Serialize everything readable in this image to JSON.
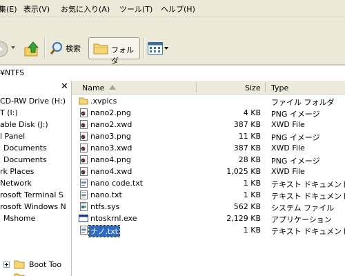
{
  "menu": {
    "items": [
      "集(E)",
      "表示(V)",
      "お気に入り(A)",
      "ツール(T)",
      "ヘルプ(H)"
    ]
  },
  "toolbar": {
    "search_label": "検索",
    "folders_label": "フォルダ"
  },
  "address": {
    "value": "¥NTFS"
  },
  "tree": {
    "items": [
      "CD-RW Drive (H:)",
      "T (I:)",
      "able Disk (J:)",
      "l Panel",
      "Documents",
      "Documents",
      "rk Places",
      "Network",
      "rosoft Terminal S",
      "rosoft Windows N",
      "Mshome",
      "Boot Too"
    ]
  },
  "list": {
    "columns": {
      "name": "Name",
      "size": "Size",
      "type": "Type"
    },
    "files": [
      {
        "name": ".xvpics",
        "size": "",
        "type": "ファイル フォルダ",
        "icon": "folder-icon"
      },
      {
        "name": "nano2.png",
        "size": "4 KB",
        "type": "PNG イメージ",
        "icon": "image-file-icon"
      },
      {
        "name": "nano2.xwd",
        "size": "387 KB",
        "type": "XWD File",
        "icon": "image-file-icon"
      },
      {
        "name": "nano3.png",
        "size": "11 KB",
        "type": "PNG イメージ",
        "icon": "image-file-icon"
      },
      {
        "name": "nano3.xwd",
        "size": "387 KB",
        "type": "XWD File",
        "icon": "image-file-icon"
      },
      {
        "name": "nano4.png",
        "size": "28 KB",
        "type": "PNG イメージ",
        "icon": "image-file-icon"
      },
      {
        "name": "nano4.xwd",
        "size": "1,025 KB",
        "type": "XWD File",
        "icon": "image-file-icon"
      },
      {
        "name": "nano code.txt",
        "size": "1 KB",
        "type": "テキスト ドキュメント",
        "icon": "text-file-icon"
      },
      {
        "name": "nano.txt",
        "size": "1 KB",
        "type": "テキスト ドキュメント",
        "icon": "text-file-icon"
      },
      {
        "name": "ntfs.sys",
        "size": "562 KB",
        "type": "システム ファイル",
        "icon": "system-file-icon"
      },
      {
        "name": "ntoskrnl.exe",
        "size": "2,129 KB",
        "type": "アプリケーション",
        "icon": "application-icon"
      },
      {
        "name": "ナノ.txt",
        "size": "1 KB",
        "type": "テキスト ドキュメント",
        "icon": "text-file-icon"
      }
    ]
  },
  "colors": {
    "selection": "#316ac5",
    "chrome": "#ece9d8"
  }
}
